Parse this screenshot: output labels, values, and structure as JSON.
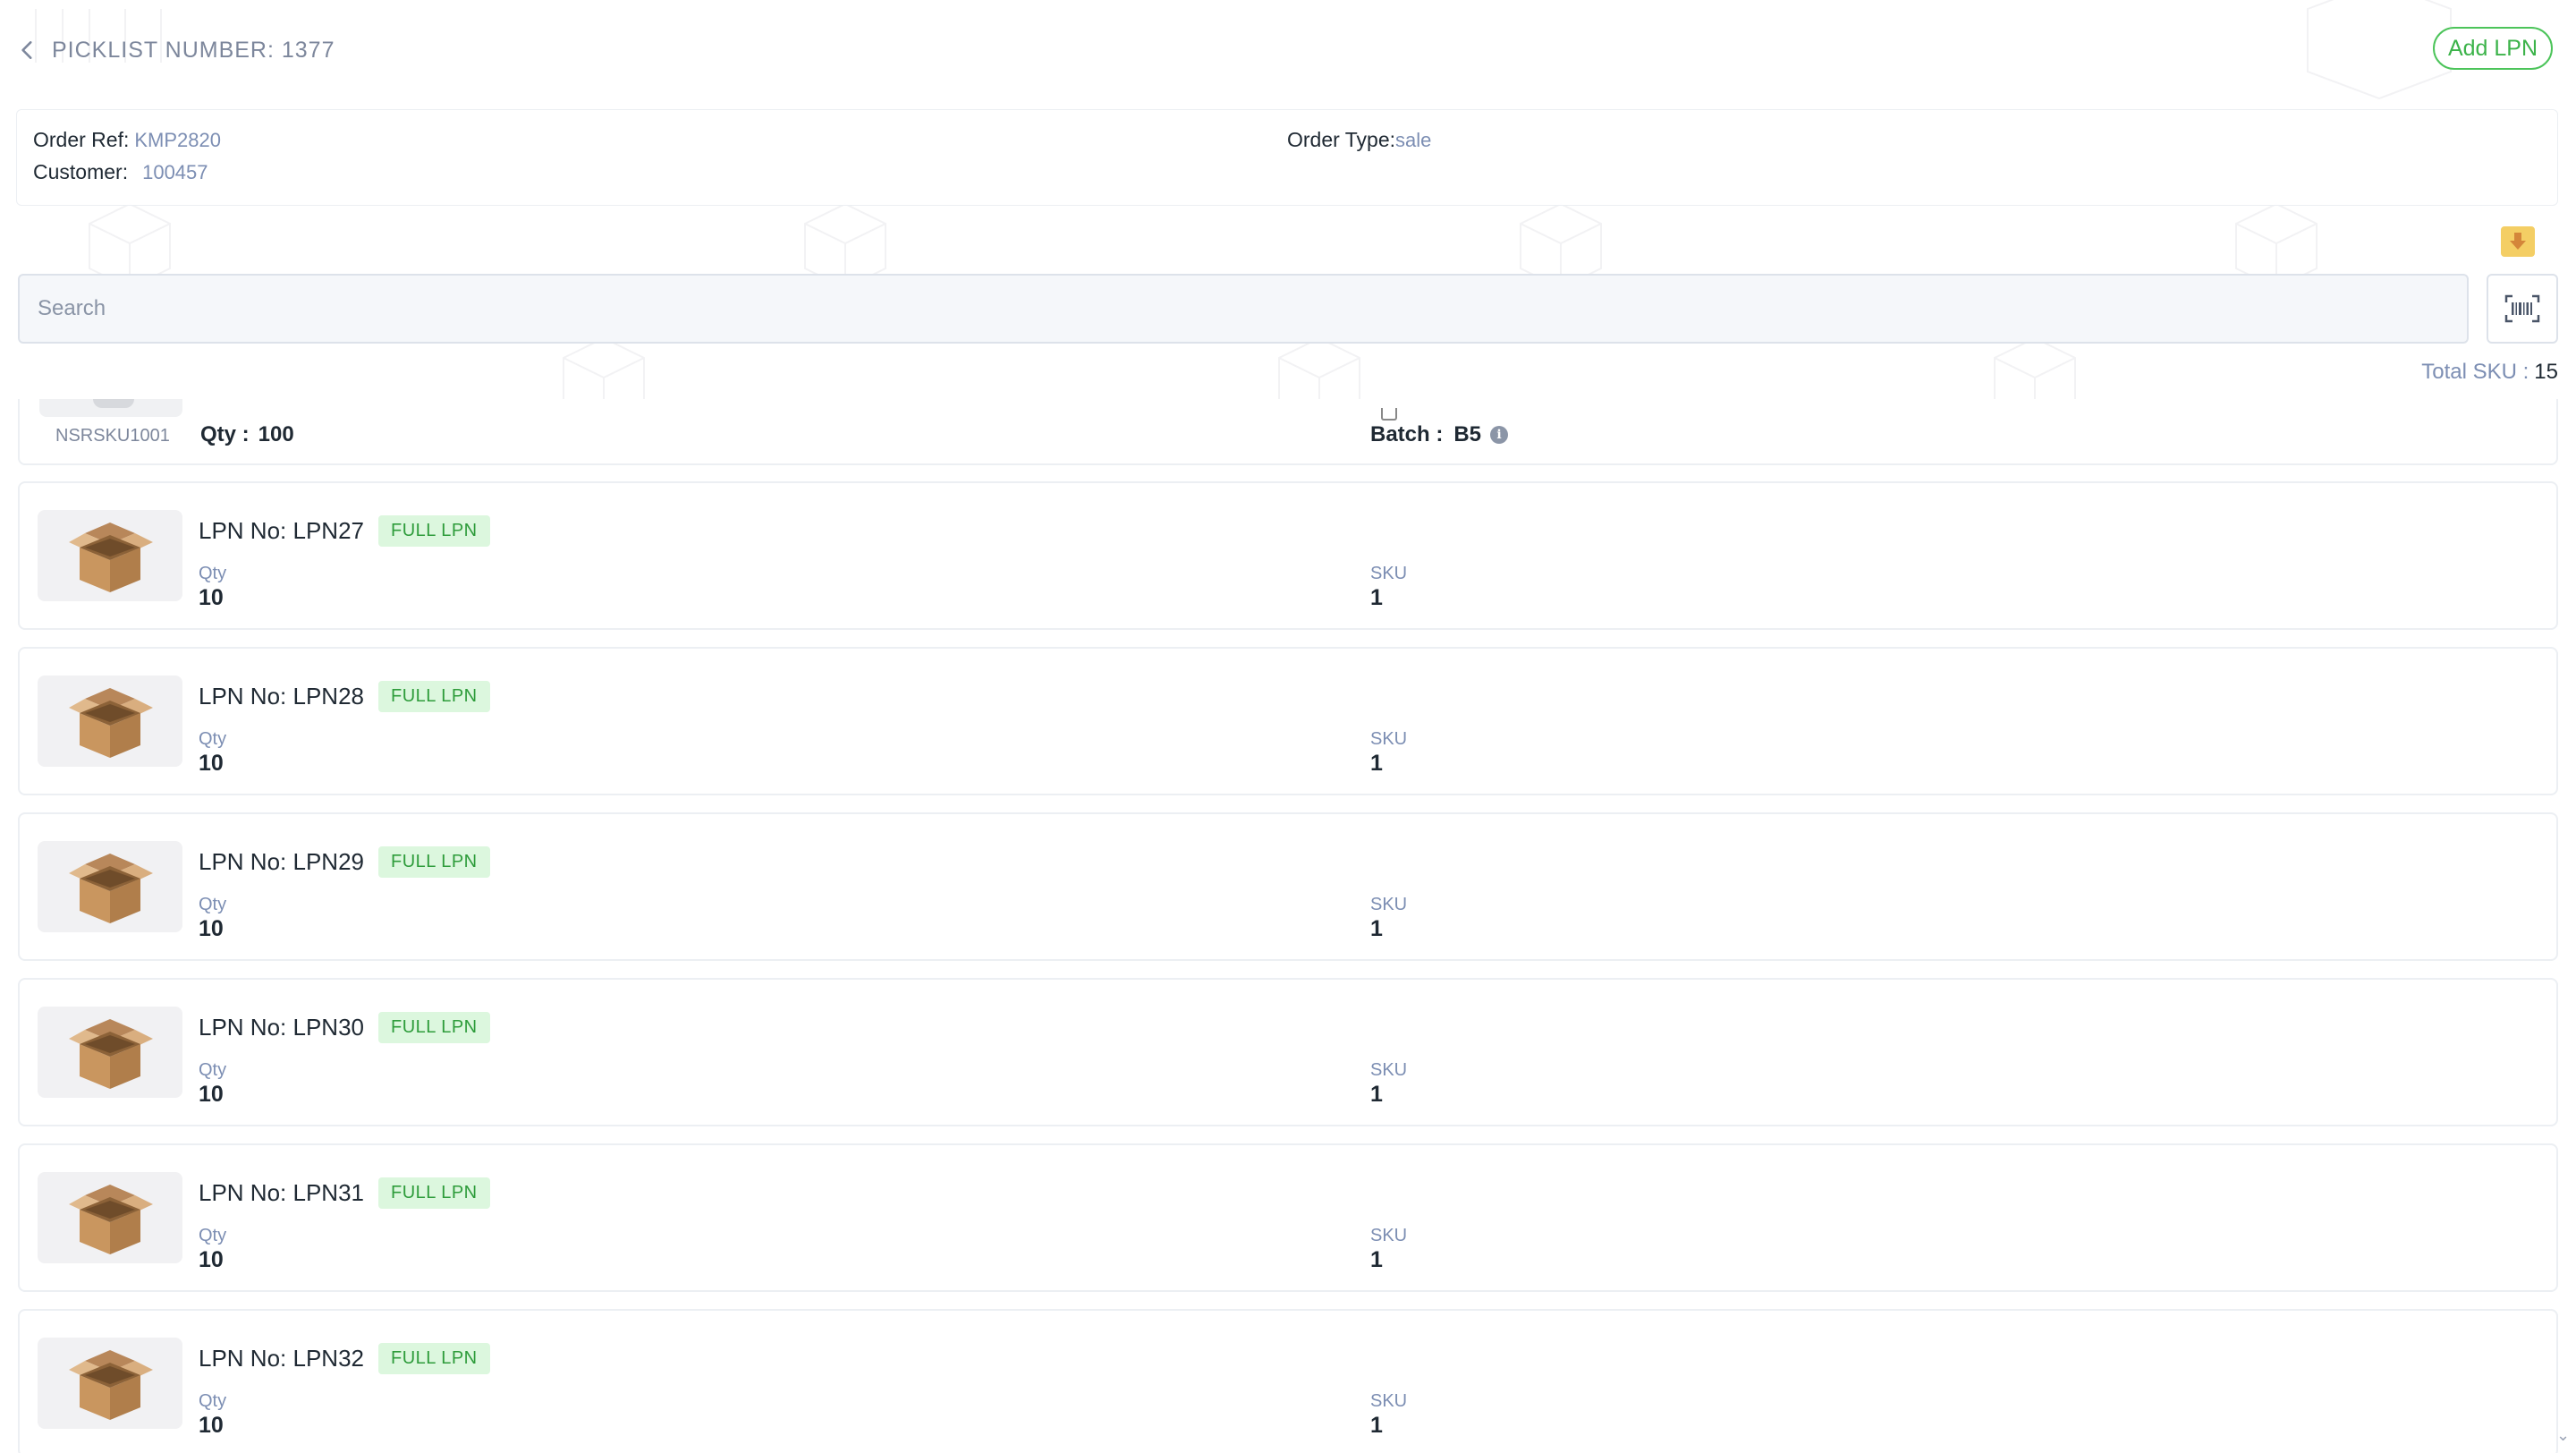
{
  "header": {
    "title": "PICKLIST NUMBER: 1377",
    "add_lpn_label": "Add LPN"
  },
  "order": {
    "ref_label": "Order Ref:",
    "ref_value": "KMP2820",
    "customer_label": "Customer:",
    "customer_value": "100457",
    "type_label": "Order Type:",
    "type_value": "sale"
  },
  "search": {
    "placeholder": "Search"
  },
  "summary": {
    "total_sku_label": "Total SKU :",
    "total_sku_value": "15"
  },
  "partial_item": {
    "sku_code": "NSRSKU1001",
    "qty_label": "Qty :",
    "qty_value": "100",
    "batch_label": "Batch :",
    "batch_value": "B5"
  },
  "lpn_items": [
    {
      "title": "LPN No: LPN27",
      "badge": "FULL LPN",
      "qty_label": "Qty",
      "qty": "10",
      "sku_label": "SKU",
      "sku": "1"
    },
    {
      "title": "LPN No: LPN28",
      "badge": "FULL LPN",
      "qty_label": "Qty",
      "qty": "10",
      "sku_label": "SKU",
      "sku": "1"
    },
    {
      "title": "LPN No: LPN29",
      "badge": "FULL LPN",
      "qty_label": "Qty",
      "qty": "10",
      "sku_label": "SKU",
      "sku": "1"
    },
    {
      "title": "LPN No: LPN30",
      "badge": "FULL LPN",
      "qty_label": "Qty",
      "qty": "10",
      "sku_label": "SKU",
      "sku": "1"
    },
    {
      "title": "LPN No: LPN31",
      "badge": "FULL LPN",
      "qty_label": "Qty",
      "qty": "10",
      "sku_label": "SKU",
      "sku": "1"
    },
    {
      "title": "LPN No: LPN32",
      "badge": "FULL LPN",
      "qty_label": "Qty",
      "qty": "10",
      "sku_label": "SKU",
      "sku": "1"
    }
  ],
  "icons": {
    "back": "chevron-left-icon",
    "download": "download-icon",
    "scanner": "barcode-scanner-icon",
    "info": "info-icon",
    "box": "cardboard-box-icon"
  },
  "colors": {
    "accent_green": "#3cb34a",
    "badge_bg": "#dcf7de",
    "badge_text": "#2e9c3b",
    "muted_blue": "#7c8eb3",
    "download_bg": "#f4ce64"
  }
}
